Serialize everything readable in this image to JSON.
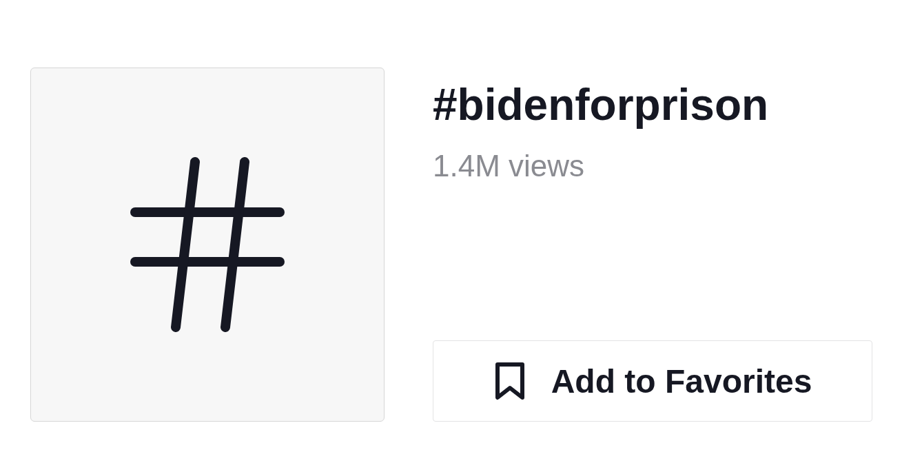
{
  "hashtag": {
    "title": "#bidenforprison",
    "views": "1.4M views"
  },
  "buttons": [
    {
      "label": "Add to Favorites",
      "kind": "bookmark"
    }
  ]
}
